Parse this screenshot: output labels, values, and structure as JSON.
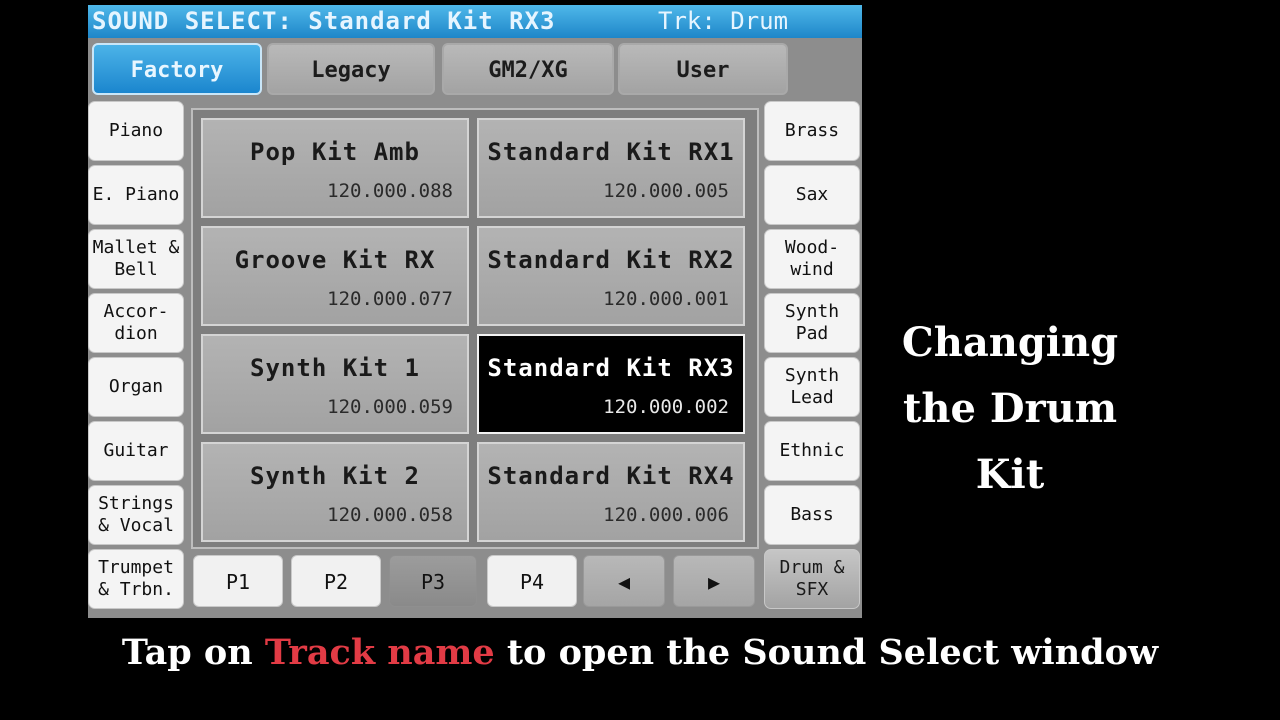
{
  "window": {
    "title": "SOUND SELECT: Standard Kit RX3",
    "track": "Trk: Drum"
  },
  "tabs": [
    {
      "label": "Factory",
      "active": true
    },
    {
      "label": "Legacy"
    },
    {
      "label": "GM2/XG"
    },
    {
      "label": "User"
    }
  ],
  "categories_left": [
    "Piano",
    "E. Piano",
    "Mallet &\nBell",
    "Accor-\ndion",
    "Organ",
    "Guitar",
    "Strings\n& Vocal",
    "Trumpet\n& Trbn."
  ],
  "categories_right": [
    "Brass",
    "Sax",
    "Wood-\nwind",
    "Synth\nPad",
    "Synth\nLead",
    "Ethnic",
    "Bass",
    "Drum &\nSFX"
  ],
  "sounds": [
    {
      "name": "Pop Kit Amb",
      "number": "120.000.088"
    },
    {
      "name": "Standard Kit RX1",
      "number": "120.000.005"
    },
    {
      "name": "Groove Kit RX",
      "number": "120.000.077"
    },
    {
      "name": "Standard Kit RX2",
      "number": "120.000.001"
    },
    {
      "name": "Synth Kit 1",
      "number": "120.000.059"
    },
    {
      "name": "Standard Kit RX3",
      "number": "120.000.002",
      "selected": true
    },
    {
      "name": "Synth Kit 2",
      "number": "120.000.058"
    },
    {
      "name": "Standard Kit RX4",
      "number": "120.000.006"
    }
  ],
  "pages": [
    "P1",
    "P2",
    "P3",
    "P4"
  ],
  "active_page": "P3",
  "arrows": {
    "prev": "◀",
    "next": "▶"
  },
  "overlay": {
    "line1": "Changing",
    "line2": "the Drum Kit"
  },
  "caption": {
    "before": "Tap on ",
    "highlight": "Track name",
    "after": " to open the Sound Select window"
  },
  "colors": {
    "accent": "#1e86c9",
    "highlight_text": "#e23b45"
  }
}
